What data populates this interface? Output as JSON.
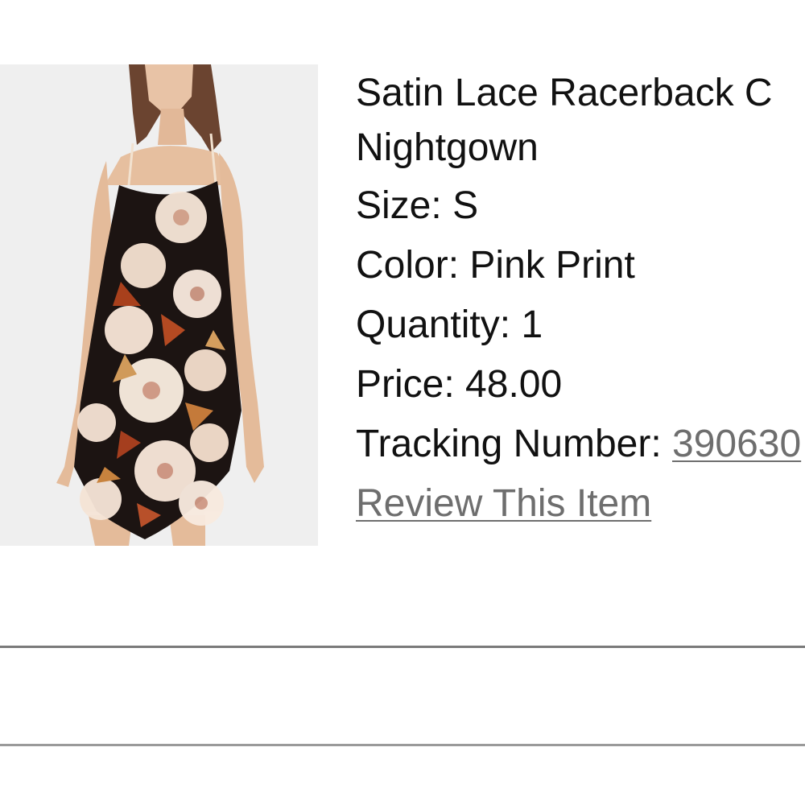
{
  "product": {
    "image_alt": "Satin Lace Racerback Nightgown in Pink Print floral",
    "title_line1": "Satin Lace Racerback C",
    "title_line2": "Nightgown",
    "size_label": "Size:",
    "size_value": "S",
    "color_label": "Color:",
    "color_value": "Pink Print",
    "quantity_label": "Quantity:",
    "quantity_value": "1",
    "price_label": "Price:",
    "price_value": "48.00",
    "tracking_label": "Tracking Number:",
    "tracking_value": "390630",
    "review_link": "Review This Item"
  },
  "colors": {
    "link": "#6e6e6e",
    "divider": "#7a7a7a"
  }
}
